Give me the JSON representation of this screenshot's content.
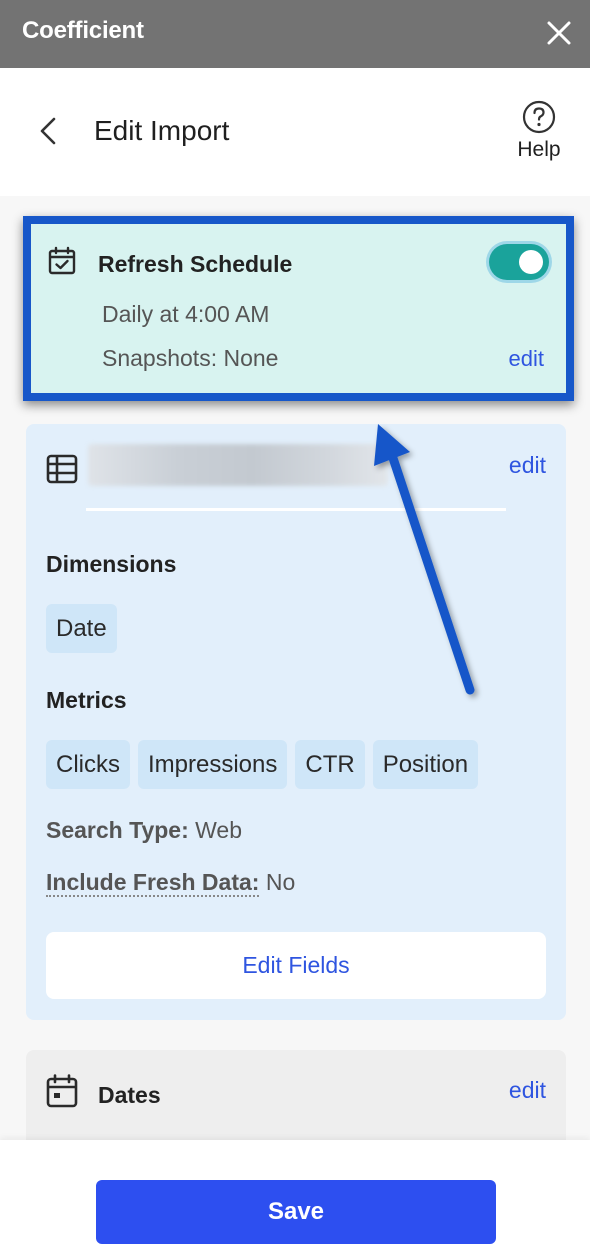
{
  "app": {
    "title": "Coefficient"
  },
  "header": {
    "title": "Edit Import",
    "help_label": "Help"
  },
  "refresh_schedule": {
    "title": "Refresh Schedule",
    "enabled": true,
    "schedule": "Daily at 4:00 AM",
    "snapshots": "Snapshots: None",
    "edit_label": "edit"
  },
  "import_details": {
    "edit_label": "edit",
    "dimensions_heading": "Dimensions",
    "dimensions": [
      "Date"
    ],
    "metrics_heading": "Metrics",
    "metrics": [
      "Clicks",
      "Impressions",
      "CTR",
      "Position"
    ],
    "search_type_label": "Search Type:",
    "search_type_value": "Web",
    "fresh_data_label": "Include Fresh Data:",
    "fresh_data_value": "No",
    "edit_fields_label": "Edit Fields"
  },
  "dates": {
    "title": "Dates",
    "edit_label": "edit"
  },
  "footer": {
    "save_label": "Save"
  },
  "colors": {
    "accent": "#2d4ff0",
    "link": "#2f55e0",
    "toggle_on": "#1aa39b",
    "highlight_border": "#1757c9",
    "titlebar": "#737373"
  }
}
